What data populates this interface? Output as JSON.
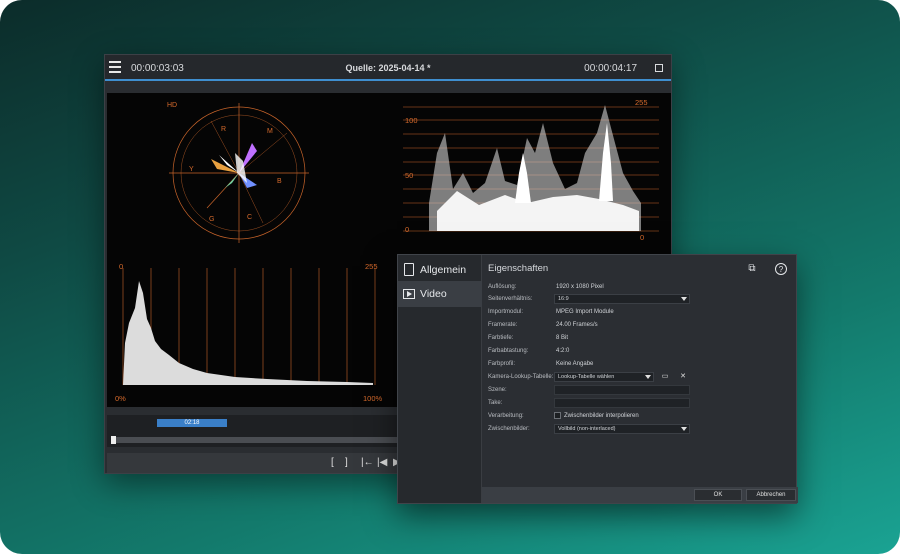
{
  "preview": {
    "timecode_left": "00:00:03:03",
    "title": "Quelle: 2025-04-14 *",
    "timecode_right": "00:00:04:17",
    "vectorscope": {
      "hd": "HD",
      "labels": [
        "R",
        "M",
        "B",
        "C",
        "G",
        "Y"
      ]
    },
    "waveform": {
      "top_right": "255",
      "bottom_right": "0",
      "ticks": [
        "100",
        "50",
        "0"
      ]
    },
    "histogram": {
      "top_left": "0",
      "top_right": "255",
      "bottom_left": "0%",
      "bottom_right": "100%"
    },
    "timeline_marker": "02:18",
    "controls": [
      "[",
      "]",
      "|←",
      "|◀",
      "▶"
    ]
  },
  "dialog": {
    "sidebar": [
      {
        "label": "Allgemein",
        "icon": "document-icon"
      },
      {
        "label": "Video",
        "icon": "video-icon"
      }
    ],
    "title": "Eigenschaften",
    "tools": {
      "copy_icon": "copy-icon",
      "help_label": "?"
    },
    "props": {
      "aufloesung": {
        "label": "Auflösung:",
        "value": "1920 x 1080 Pixel"
      },
      "seitenverhaeltnis": {
        "label": "Seitenverhältnis:",
        "value": "16:9"
      },
      "importmodul": {
        "label": "Importmodul:",
        "value": "MPEG Import Module"
      },
      "framerate": {
        "label": "Framerate:",
        "value": "24.00 Frames/s"
      },
      "farbtiefe": {
        "label": "Farbtiefe:",
        "value": "8 Bit"
      },
      "farbabtastung": {
        "label": "Farbabtastung:",
        "value": "4:2:0"
      },
      "farbprofil": {
        "label": "Farbprofil:",
        "value": "Keine Angabe"
      },
      "kamera_lut": {
        "label": "Kamera-Lookup-Tabelle:",
        "value": "Lookup-Tabelle wählen"
      },
      "szene": {
        "label": "Szene:",
        "value": ""
      },
      "take": {
        "label": "Take:",
        "value": ""
      },
      "verarbeitung": {
        "label": "Verarbeitung:",
        "value": "Zwischenbilder interpolieren"
      },
      "zwischenbilder": {
        "label": "Zwischenbilder:",
        "value": "Vollbild (non-interlaced)"
      }
    },
    "buttons": {
      "ok": "OK",
      "cancel": "Abbrechen"
    }
  }
}
